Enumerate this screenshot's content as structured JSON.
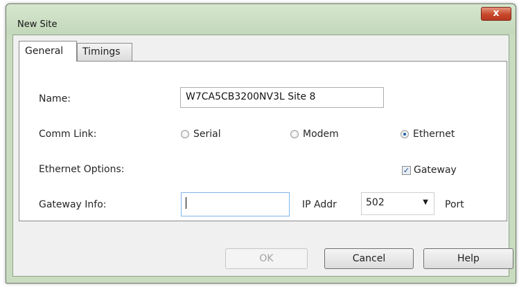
{
  "window": {
    "title": "New Site",
    "close_glyph": "x"
  },
  "tabs": [
    {
      "label": "General"
    },
    {
      "label": "Timings"
    }
  ],
  "form": {
    "name_label": "Name:",
    "name_value": "W7CA5CB3200NV3L Site 8",
    "comm_link_label": "Comm Link:",
    "comm_link_options": [
      {
        "label": "Serial",
        "selected": false
      },
      {
        "label": "Modem",
        "selected": false
      },
      {
        "label": "Ethernet",
        "selected": true
      }
    ],
    "ethernet_options_label": "Ethernet Options:",
    "gateway_checkbox": {
      "label": "Gateway",
      "checked": true
    },
    "gateway_info_label": "Gateway Info:",
    "ip_addr_value": "",
    "ip_addr_label": "IP Addr",
    "port_value": "502",
    "port_label": "Port"
  },
  "buttons": {
    "ok": "OK",
    "cancel": "Cancel",
    "help": "Help"
  }
}
